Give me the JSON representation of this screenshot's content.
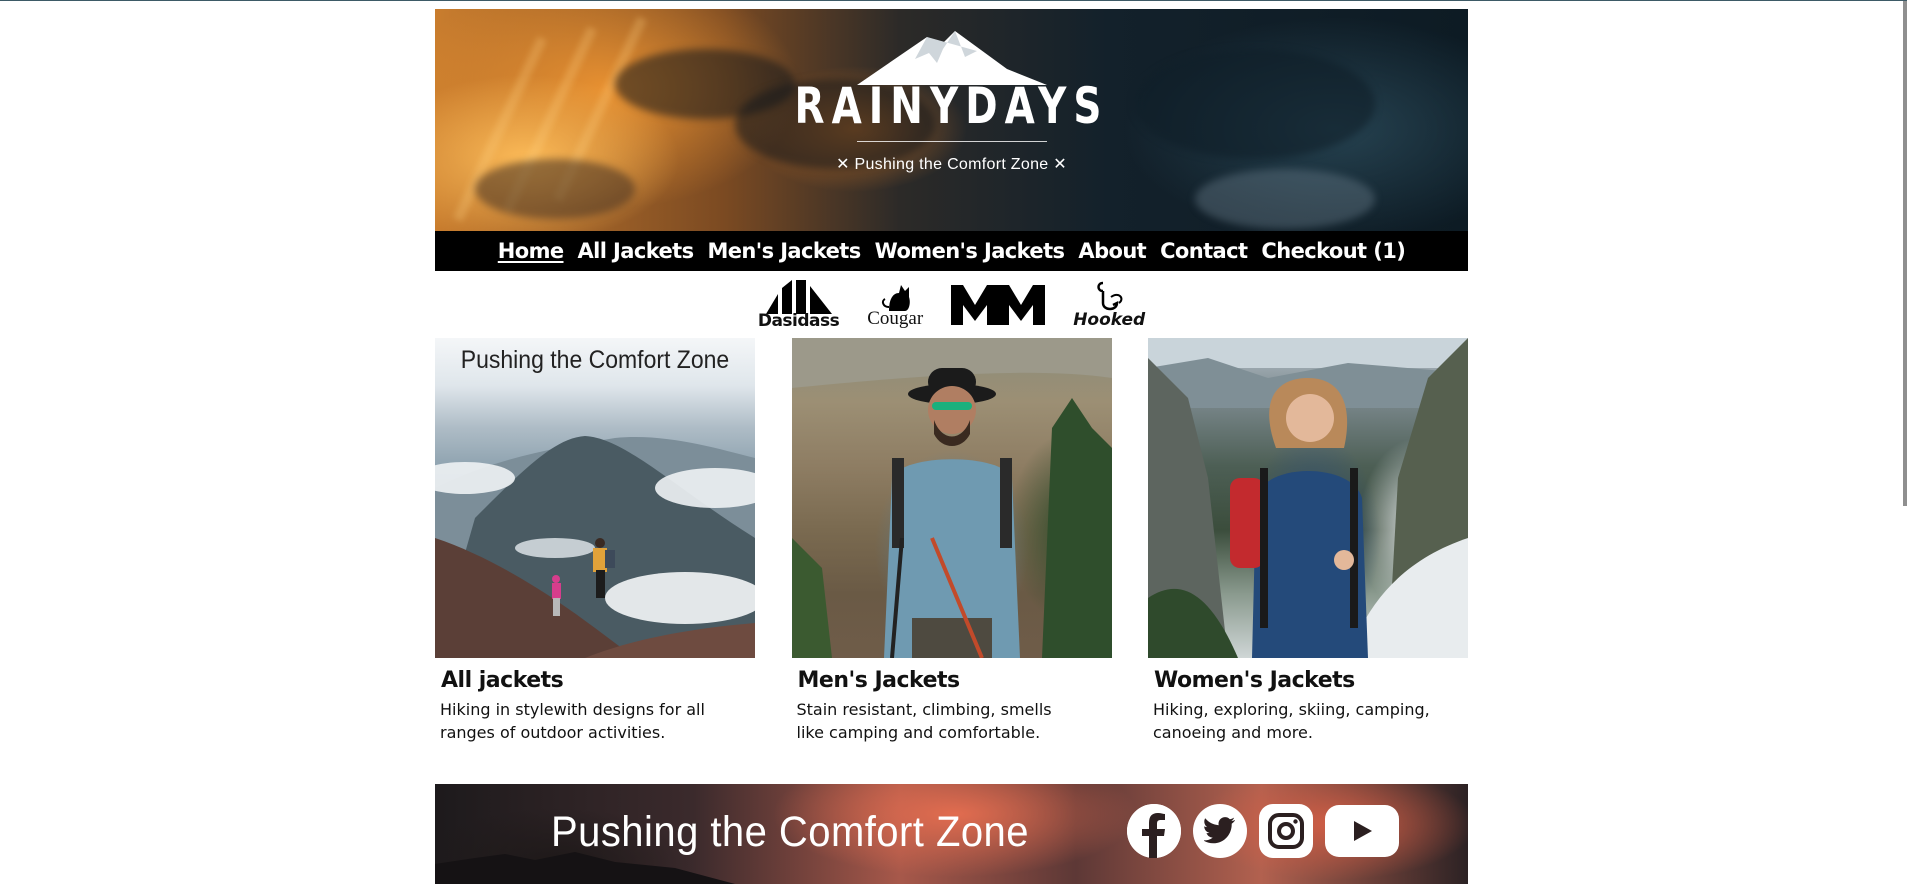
{
  "header": {
    "logo": "RAINYDAYS",
    "tagline": "✕ Pushing the Comfort Zone ✕"
  },
  "nav": {
    "items": [
      {
        "label": "Home",
        "active": true
      },
      {
        "label": "All Jackets"
      },
      {
        "label": "Men's Jackets"
      },
      {
        "label": "Women's Jackets"
      },
      {
        "label": "About"
      },
      {
        "label": "Contact"
      },
      {
        "label": "Checkout (1)"
      }
    ]
  },
  "brands": {
    "dasidass": "Dasidass",
    "cougar": "Cougar",
    "mm": "MM",
    "hooked": "Hooked"
  },
  "cards": [
    {
      "image_caption": "Pushing the Comfort Zone",
      "title": "All jackets",
      "description": "Hiking in stylewith designs for all ranges of outdoor activities."
    },
    {
      "title": "Men's Jackets",
      "description": "Stain resistant, climbing, smells like camping and comfortable."
    },
    {
      "title": "Women's Jackets",
      "description": "Hiking, exploring, skiing, camping, canoeing and more."
    }
  ],
  "footer_banner": {
    "text": "Pushing the Comfort Zone",
    "social": [
      "facebook-icon",
      "twitter-icon",
      "instagram-icon",
      "youtube-icon"
    ]
  },
  "colors": {
    "nav_bg": "#000000",
    "nav_text": "#ffffff",
    "page_bg": "#ffffff"
  }
}
